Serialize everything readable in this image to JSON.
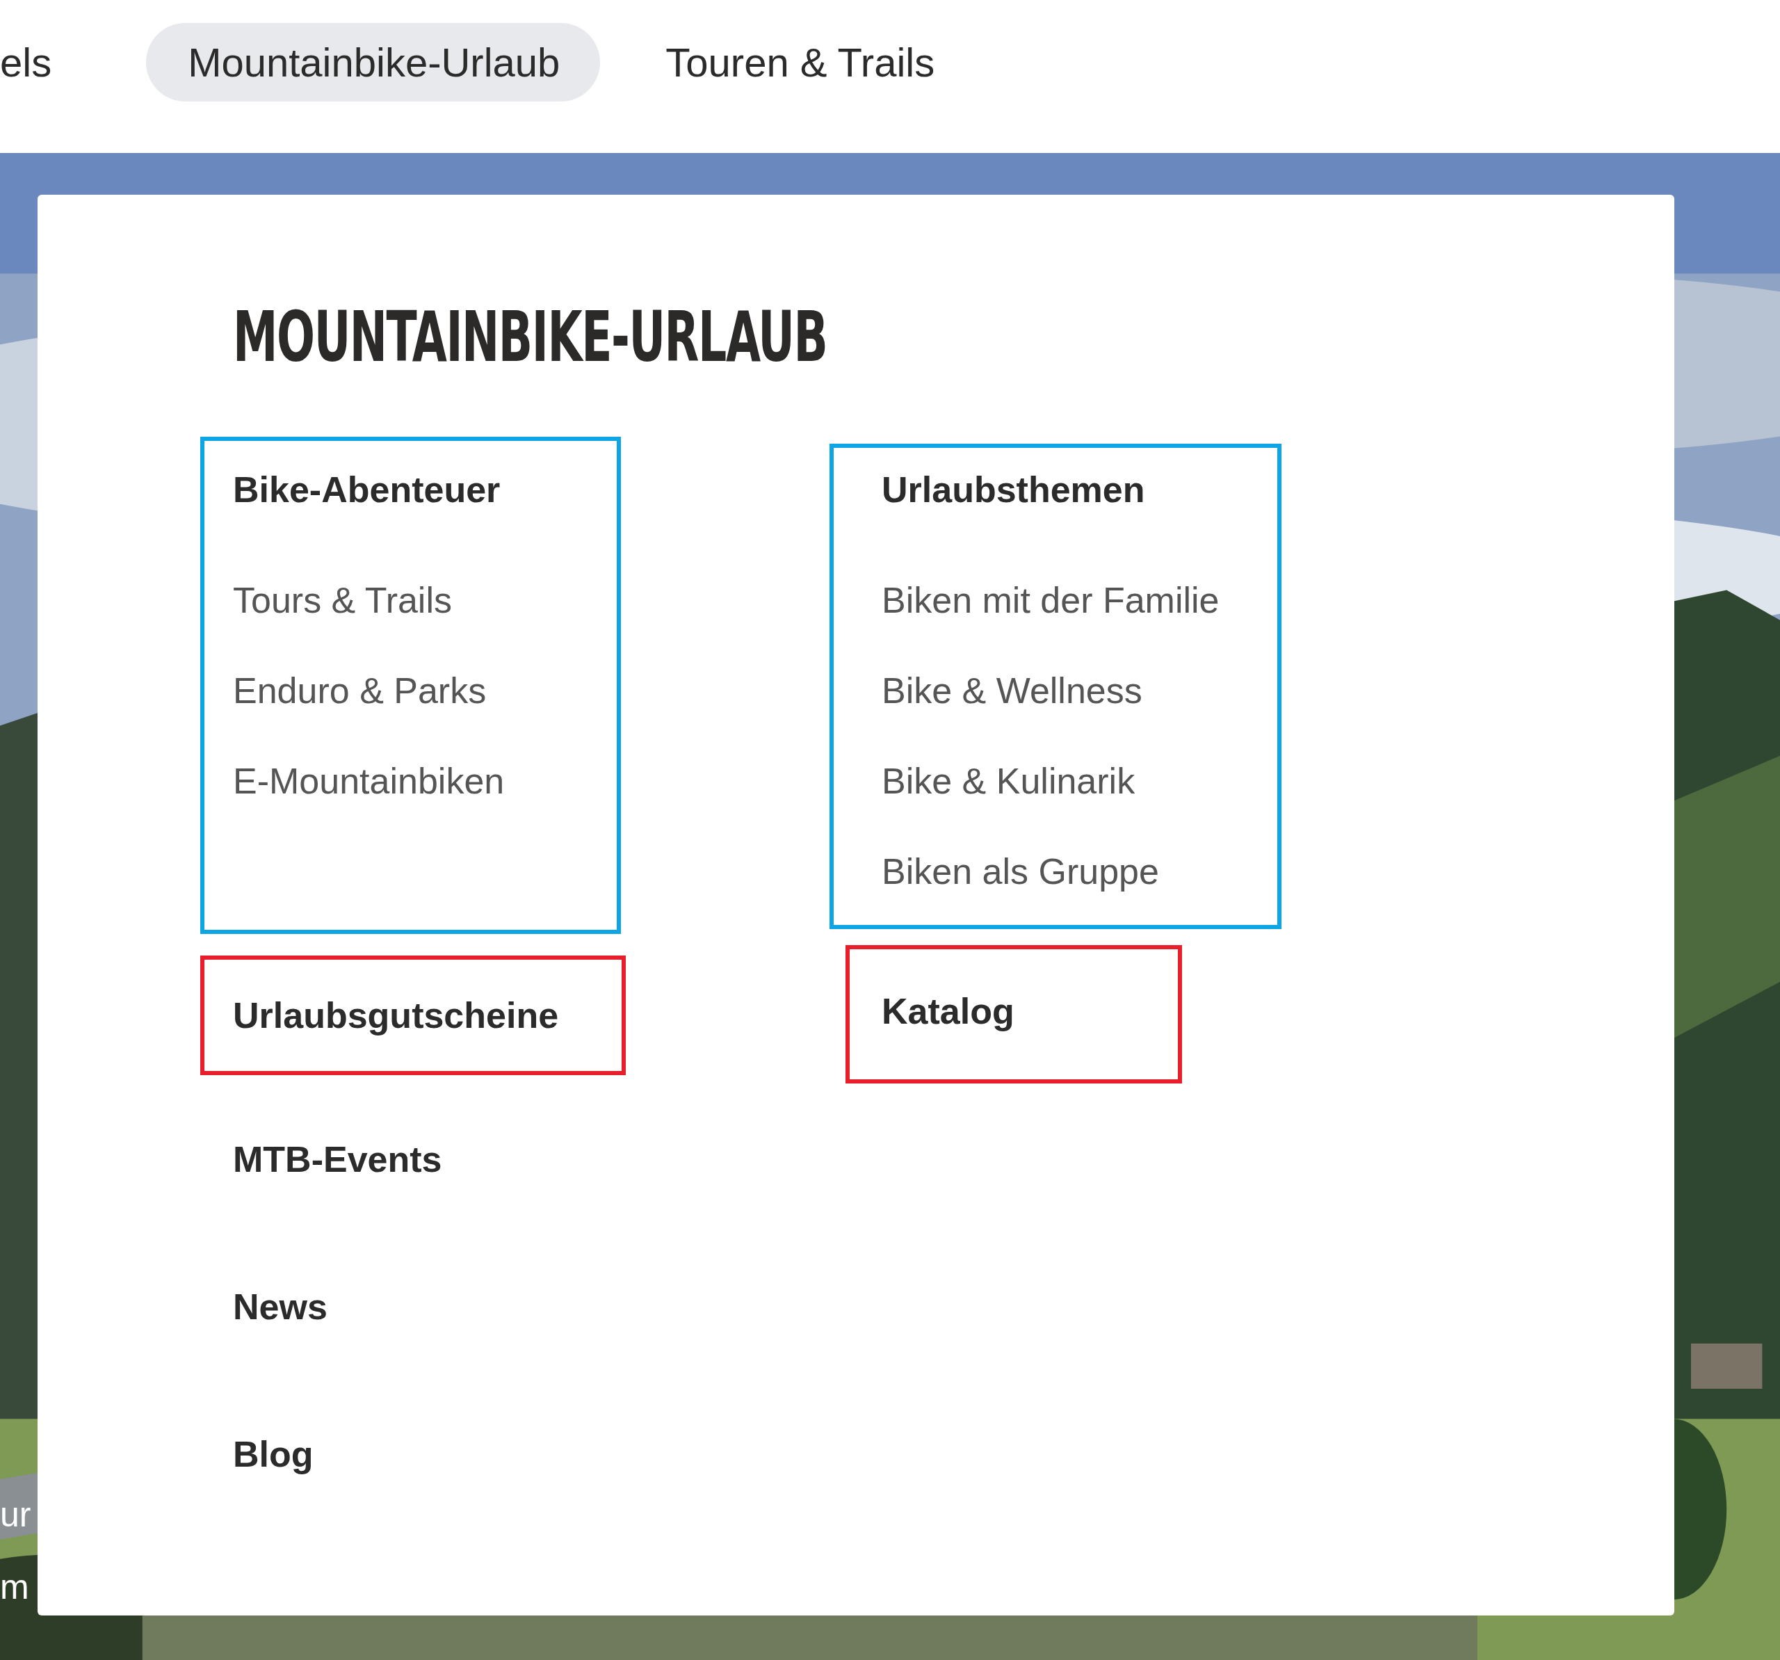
{
  "nav": [
    {
      "label": "els",
      "selected": false
    },
    {
      "label": "Mountainbike-Urlaub",
      "selected": true
    },
    {
      "label": "Touren & Trails",
      "selected": false
    }
  ],
  "hero_texts": [
    "ur",
    "m"
  ],
  "menu": {
    "title": "MOUNTAINBIKE-URLAUB",
    "columns": [
      {
        "heading": "Bike-Abenteuer",
        "color": "#0ea5e4",
        "links": [
          "Tours & Trails",
          "Enduro & Parks",
          "E-Mountainbiken"
        ]
      },
      {
        "heading": "Urlaubsthemen",
        "color": "#0ea5e4",
        "links": [
          "Biken mit der Familie",
          "Bike & Wellness",
          "Bike & Kulinarik",
          "Biken als Gruppe"
        ]
      }
    ],
    "featured": [
      {
        "label": "Urlaubsgutscheine",
        "color": "#e81e2a"
      },
      {
        "label": "Katalog",
        "color": "#e81e2a"
      }
    ],
    "items": [
      "MTB-Events",
      "News",
      "Blog"
    ]
  }
}
